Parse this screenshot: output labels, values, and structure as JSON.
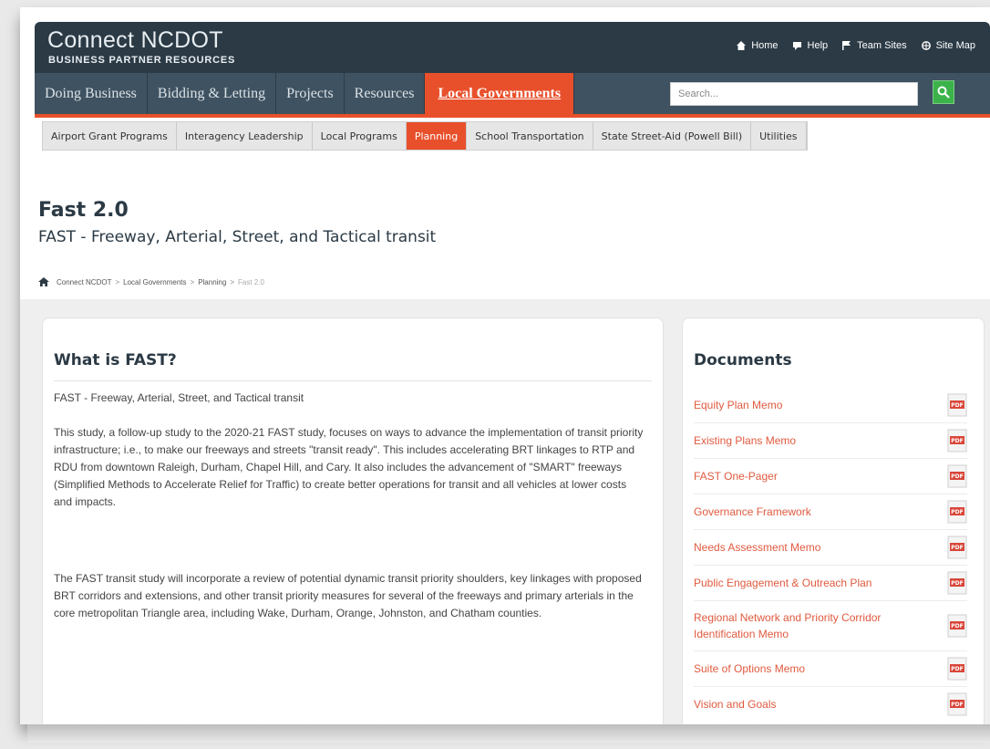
{
  "header": {
    "logo_main": "Connect NCDOT",
    "logo_sub": "BUSINESS PARTNER RESOURCES",
    "utility_links": [
      {
        "label": "Home",
        "icon": "home-icon"
      },
      {
        "label": "Help",
        "icon": "help-icon"
      },
      {
        "label": "Team Sites",
        "icon": "flag-icon"
      },
      {
        "label": "Site Map",
        "icon": "globe-icon"
      }
    ]
  },
  "nav": {
    "items": [
      {
        "label": "Doing Business"
      },
      {
        "label": "Bidding & Letting"
      },
      {
        "label": "Projects"
      },
      {
        "label": "Resources"
      },
      {
        "label": "Local Governments",
        "active": true
      }
    ],
    "search_placeholder": "Search..."
  },
  "subnav": {
    "items": [
      {
        "label": "Airport Grant Programs"
      },
      {
        "label": "Interagency Leadership"
      },
      {
        "label": "Local Programs"
      },
      {
        "label": "Planning",
        "active": true
      },
      {
        "label": "School Transportation"
      },
      {
        "label": "State Street-Aid (Powell Bill)"
      },
      {
        "label": "Utilities"
      }
    ]
  },
  "page": {
    "title": "Fast 2.0",
    "subtitle": "FAST - Freeway, Arterial, Street, and Tactical transit"
  },
  "breadcrumb": {
    "items": [
      "Connect NCDOT",
      "Local Governments",
      "Planning",
      "Fast 2.0"
    ],
    "separator": ">"
  },
  "main": {
    "heading": "What is FAST?",
    "paragraphs": [
      "FAST - Freeway, Arterial, Street, and Tactical transit",
      "This study, a follow-up study to the 2020-21 FAST study, focuses on ways to advance the implementation of transit priority infrastructure; i.e., to make our freeways and streets \"transit ready\". This includes accelerating BRT linkages to RTP and RDU from downtown Raleigh, Durham, Chapel Hill, and Cary. It also includes the advancement of \"SMART\" freeways (Simplified Methods to Accelerate Relief for Traffic) to create better operations for transit and all vehicles at lower costs and impacts.",
      "The FAST transit study will incorporate a review of potential dynamic transit priority shoulders, key linkages with proposed BRT corridors and extensions, and other transit priority measures for several of the freeways and primary arterials in the core metropolitan Triangle area, including Wake, Durham, Orange, Johnston, and Chatham counties."
    ]
  },
  "documents": {
    "heading": "Documents",
    "items": [
      {
        "label": "Equity Plan Memo"
      },
      {
        "label": "Existing Plans Memo"
      },
      {
        "label": "FAST One-Pager"
      },
      {
        "label": "Governance Framework"
      },
      {
        "label": "Needs Assessment Memo"
      },
      {
        "label": "Public Engagement & Outreach Plan"
      },
      {
        "label": "Regional Network and Priority Corridor Identification Memo"
      },
      {
        "label": "Suite of Options Memo"
      },
      {
        "label": "Vision and Goals"
      }
    ],
    "icon": "pdf-icon"
  },
  "colors": {
    "header_bg": "#2b3a45",
    "nav_bg": "#3f5261",
    "accent": "#e8502c",
    "link": "#e05a3f",
    "search_button": "#3bb34a"
  }
}
